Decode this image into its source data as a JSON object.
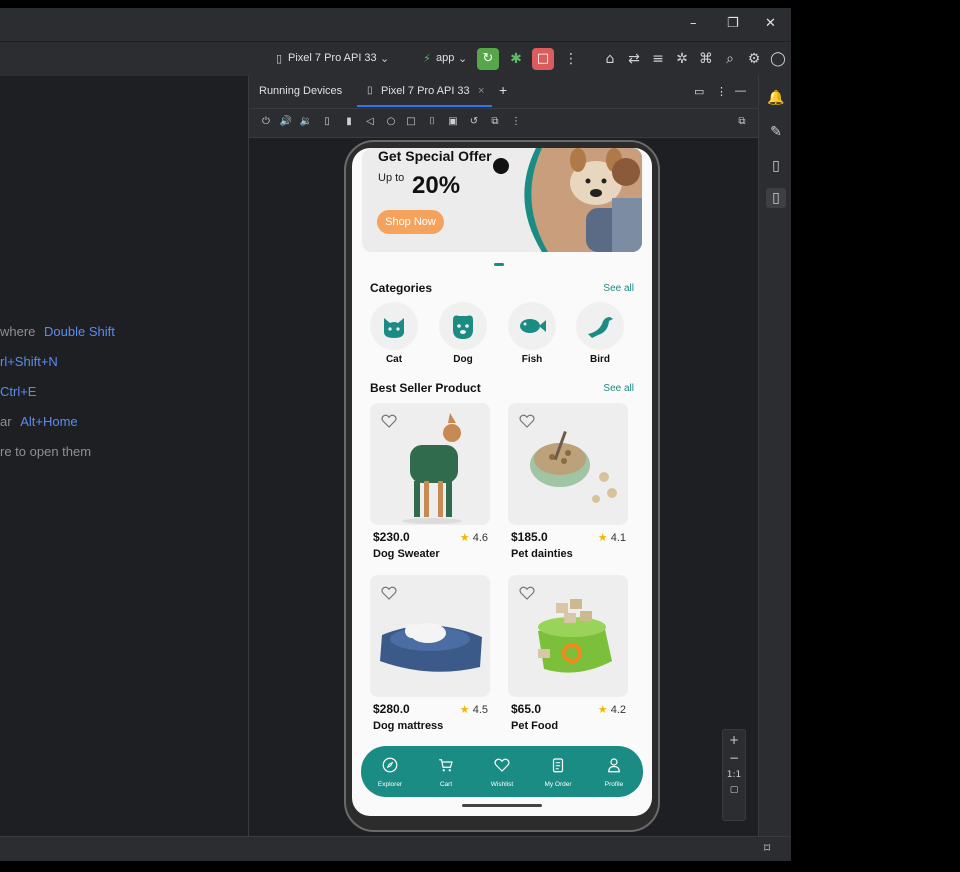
{
  "ide": {
    "window_controls": {
      "minimize": "–",
      "restore": "❐",
      "close": "✕"
    },
    "device_selector": "Pixel 7 Pro API 33",
    "app_selector": "app",
    "hints": [
      {
        "text": "where",
        "key": "Double Shift"
      },
      {
        "text": "",
        "key": "rl+Shift+N"
      },
      {
        "text": "",
        "key": "Ctrl+E"
      },
      {
        "text": "ar",
        "key": "Alt+Home"
      },
      {
        "text": "re to open them",
        "key": ""
      }
    ],
    "running_devices_label": "Running Devices",
    "device_tab": "Pixel 7 Pro API 33",
    "zoom_ratio": "1:1"
  },
  "app": {
    "banner": {
      "title": "Get Special Offer",
      "upto": "Up to",
      "percent": "20%",
      "cta": "Shop Now"
    },
    "categories_title": "Categories",
    "see_all": "See all",
    "categories": [
      {
        "label": "Cat",
        "icon": "cat-icon"
      },
      {
        "label": "Dog",
        "icon": "dog-icon"
      },
      {
        "label": "Fish",
        "icon": "fish-icon"
      },
      {
        "label": "Bird",
        "icon": "bird-icon"
      }
    ],
    "best_seller_title": "Best Seller Product",
    "products": [
      {
        "price": "$230.0",
        "rating": "4.6",
        "name": "Dog Sweater"
      },
      {
        "price": "$185.0",
        "rating": "4.1",
        "name": "Pet dainties"
      },
      {
        "price": "$280.0",
        "rating": "4.5",
        "name": "Dog mattress"
      },
      {
        "price": "$65.0",
        "rating": "4.2",
        "name": "Pet Food"
      }
    ],
    "nav": [
      {
        "label": "Explorer",
        "icon": "compass-icon"
      },
      {
        "label": "Cart",
        "icon": "cart-icon"
      },
      {
        "label": "Wishlist",
        "icon": "heart-icon"
      },
      {
        "label": "My Order",
        "icon": "clipboard-icon"
      },
      {
        "label": "Profile",
        "icon": "user-icon"
      }
    ],
    "colors": {
      "accent": "#1b8c84",
      "cta": "#f5a25d",
      "star": "#f2b705"
    }
  }
}
